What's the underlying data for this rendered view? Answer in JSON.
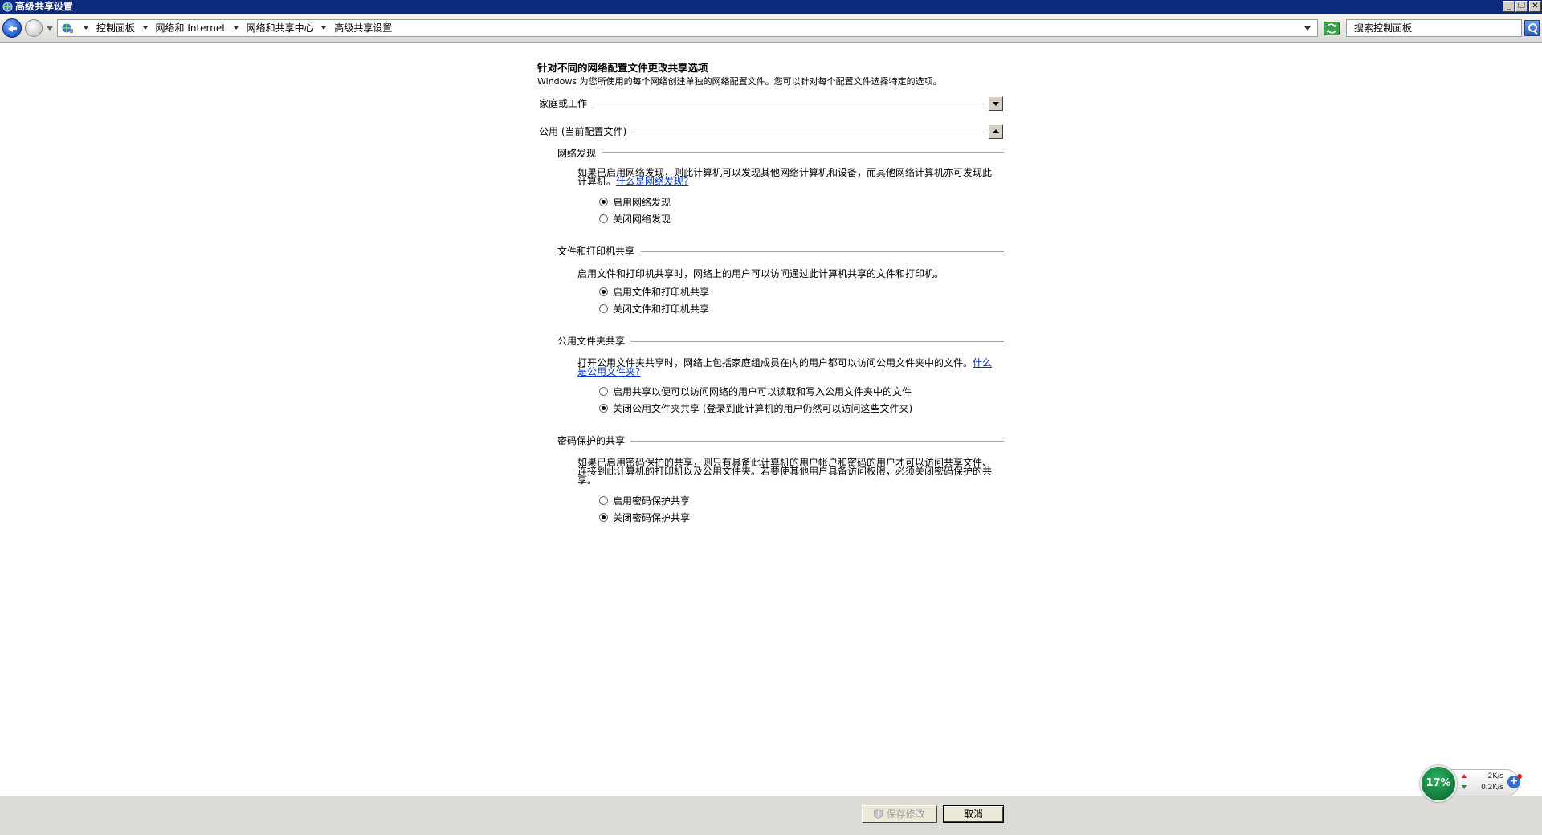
{
  "window": {
    "title": "高级共享设置",
    "buttons": {
      "minimize": "_",
      "restore": "❐",
      "close": "✕"
    }
  },
  "address_bar": {
    "breadcrumbs": [
      "控制面板",
      "网络和 Internet",
      "网络和共享中心",
      "高级共享设置"
    ],
    "search_placeholder": "搜索控制面板"
  },
  "main": {
    "heading": "针对不同的网络配置文件更改共享选项",
    "description": "Windows 为您所使用的每个网络创建单独的网络配置文件。您可以针对每个配置文件选择特定的选项。",
    "profiles": {
      "home_work": {
        "label": "家庭或工作"
      },
      "public": {
        "label": "公用 (当前配置文件)"
      }
    },
    "sections": {
      "network_discovery": {
        "title": "网络发现",
        "text": "如果已启用网络发现，则此计算机可以发现其他网络计算机和设备，而其他网络计算机亦可发现此计算机。",
        "link": "什么是网络发现?",
        "options": [
          "启用网络发现",
          "关闭网络发现"
        ],
        "selected": 0
      },
      "file_printer_sharing": {
        "title": "文件和打印机共享",
        "text": "启用文件和打印机共享时，网络上的用户可以访问通过此计算机共享的文件和打印机。",
        "options": [
          "启用文件和打印机共享",
          "关闭文件和打印机共享"
        ],
        "selected": 0
      },
      "public_folder_sharing": {
        "title": "公用文件夹共享",
        "text": "打开公用文件夹共享时，网络上包括家庭组成员在内的用户都可以访问公用文件夹中的文件。",
        "link": "什么是公用文件夹?",
        "options": [
          "启用共享以便可以访问网络的用户可以读取和写入公用文件夹中的文件",
          "关闭公用文件夹共享 (登录到此计算机的用户仍然可以访问这些文件夹)"
        ],
        "selected": 1
      },
      "password_sharing": {
        "title": "密码保护的共享",
        "text": "如果已启用密码保护的共享，则只有具备此计算机的用户帐户和密码的用户才可以访问共享文件、连接到此计算机的打印机以及公用文件夹。若要使其他用户具备访问权限，必须关闭密码保护的共享。",
        "options": [
          "启用密码保护共享",
          "关闭密码保护共享"
        ],
        "selected": 1
      }
    }
  },
  "footer": {
    "save_label": "保存修改",
    "cancel_label": "取消"
  },
  "net_widget": {
    "percent": "17%",
    "up": "2K/s",
    "down": "0.2K/s",
    "plus": "+"
  }
}
